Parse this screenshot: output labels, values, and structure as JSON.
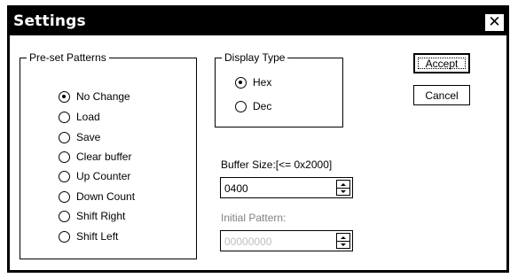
{
  "window": {
    "title": "Settings",
    "close_symbol": "✕"
  },
  "preset_patterns": {
    "label": "Pre-set Patterns",
    "selected": "No Change",
    "options": [
      "No Change",
      "Load",
      "Save",
      "Clear buffer",
      "Up Counter",
      "Down Count",
      "Shift Right",
      "Shift Left"
    ]
  },
  "display_type": {
    "label": "Display Type",
    "selected": "Hex",
    "options": [
      "Hex",
      "Dec"
    ]
  },
  "buttons": {
    "accept_label": "Accept",
    "cancel_label": "Cancel"
  },
  "buffer_size": {
    "label": "Buffer Size:[<= 0x2000]",
    "value": "0400"
  },
  "initial_pattern": {
    "label": "Initial Pattern:",
    "value": "00000000",
    "disabled": true
  },
  "colors": {
    "titlebar": "#000000",
    "disabled_text": "#808080"
  }
}
